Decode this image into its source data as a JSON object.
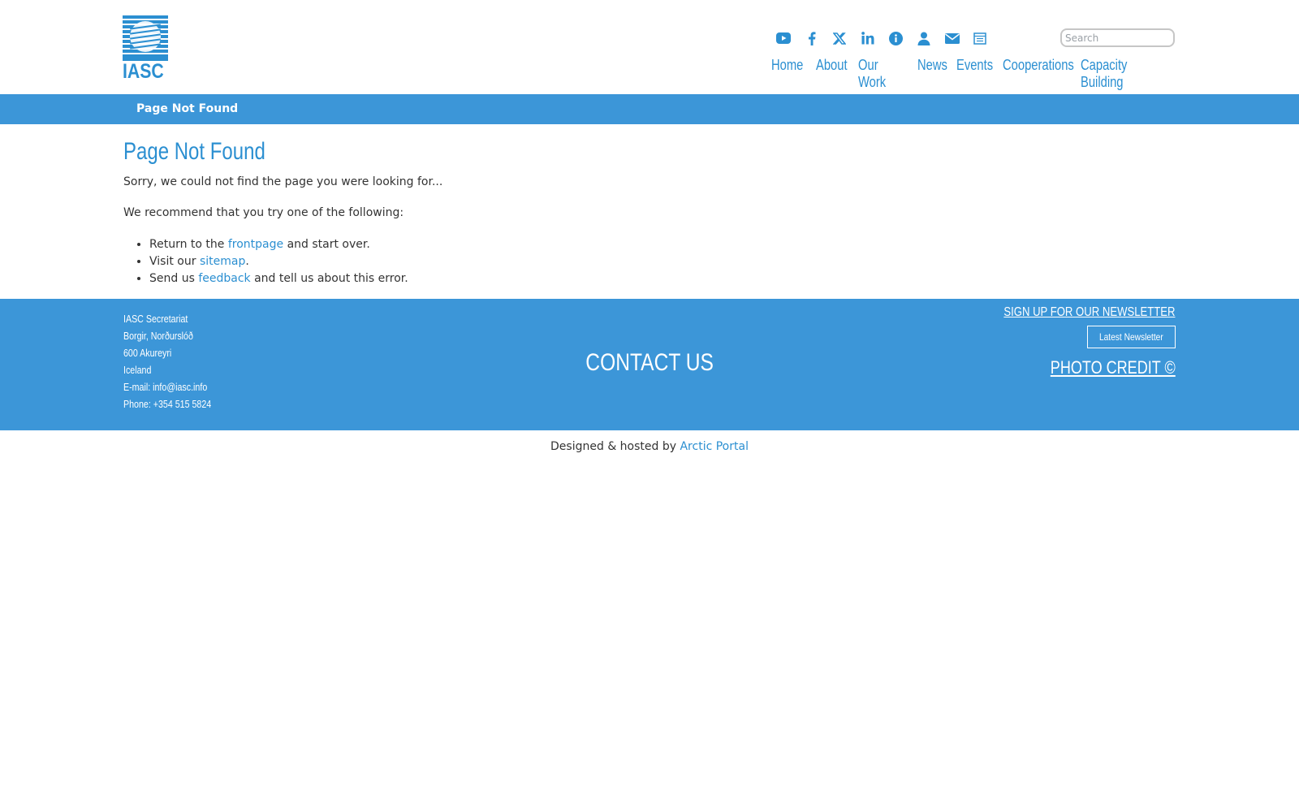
{
  "logo": {
    "text": "IASC"
  },
  "social": [
    {
      "icon": "youtube-icon"
    },
    {
      "icon": "facebook-icon"
    },
    {
      "icon": "x-twitter-icon"
    },
    {
      "icon": "linkedin-icon"
    },
    {
      "icon": "info-icon"
    },
    {
      "icon": "user-icon"
    },
    {
      "icon": "envelope-icon"
    },
    {
      "icon": "newsletter-icon"
    }
  ],
  "search": {
    "placeholder": "Search"
  },
  "nav": {
    "home": "Home",
    "about": "About",
    "our_work": "Our Work",
    "news": "News",
    "events": "Events",
    "cooperations": "Cooperations",
    "capacity_building": "Capacity Building"
  },
  "breadcrumb": "Page Not Found",
  "main": {
    "title": "Page Not Found",
    "sorry": "Sorry, we could not find the page you were looking for...",
    "recommend": "We recommend that you try one of the following:",
    "options": [
      {
        "pre": "Return to the ",
        "link": "frontpage",
        "post": " and start over."
      },
      {
        "pre": "Visit our ",
        "link": "sitemap",
        "post": "."
      },
      {
        "pre": "Send us ",
        "link": "feedback",
        "post": " and tell us about this error."
      }
    ]
  },
  "footer": {
    "address": [
      "IASC Secretariat",
      "Borgir, Norðurslóð",
      "600 Akureyri",
      "Iceland",
      "E-mail: info@iasc.info",
      "Phone: +354 515 5824"
    ],
    "contact": "CONTACT US",
    "newsletter_link": "SIGN UP FOR OUR NEWSLETTER",
    "latest_newsletter": "Latest Newsletter",
    "photo_credit": "PHOTO CREDIT ©"
  },
  "credits": {
    "prefix": "Designed & hosted by ",
    "link": "Arctic Portal"
  },
  "colors": {
    "brand": "#2b8fd1",
    "bar": "#3c96d8"
  }
}
